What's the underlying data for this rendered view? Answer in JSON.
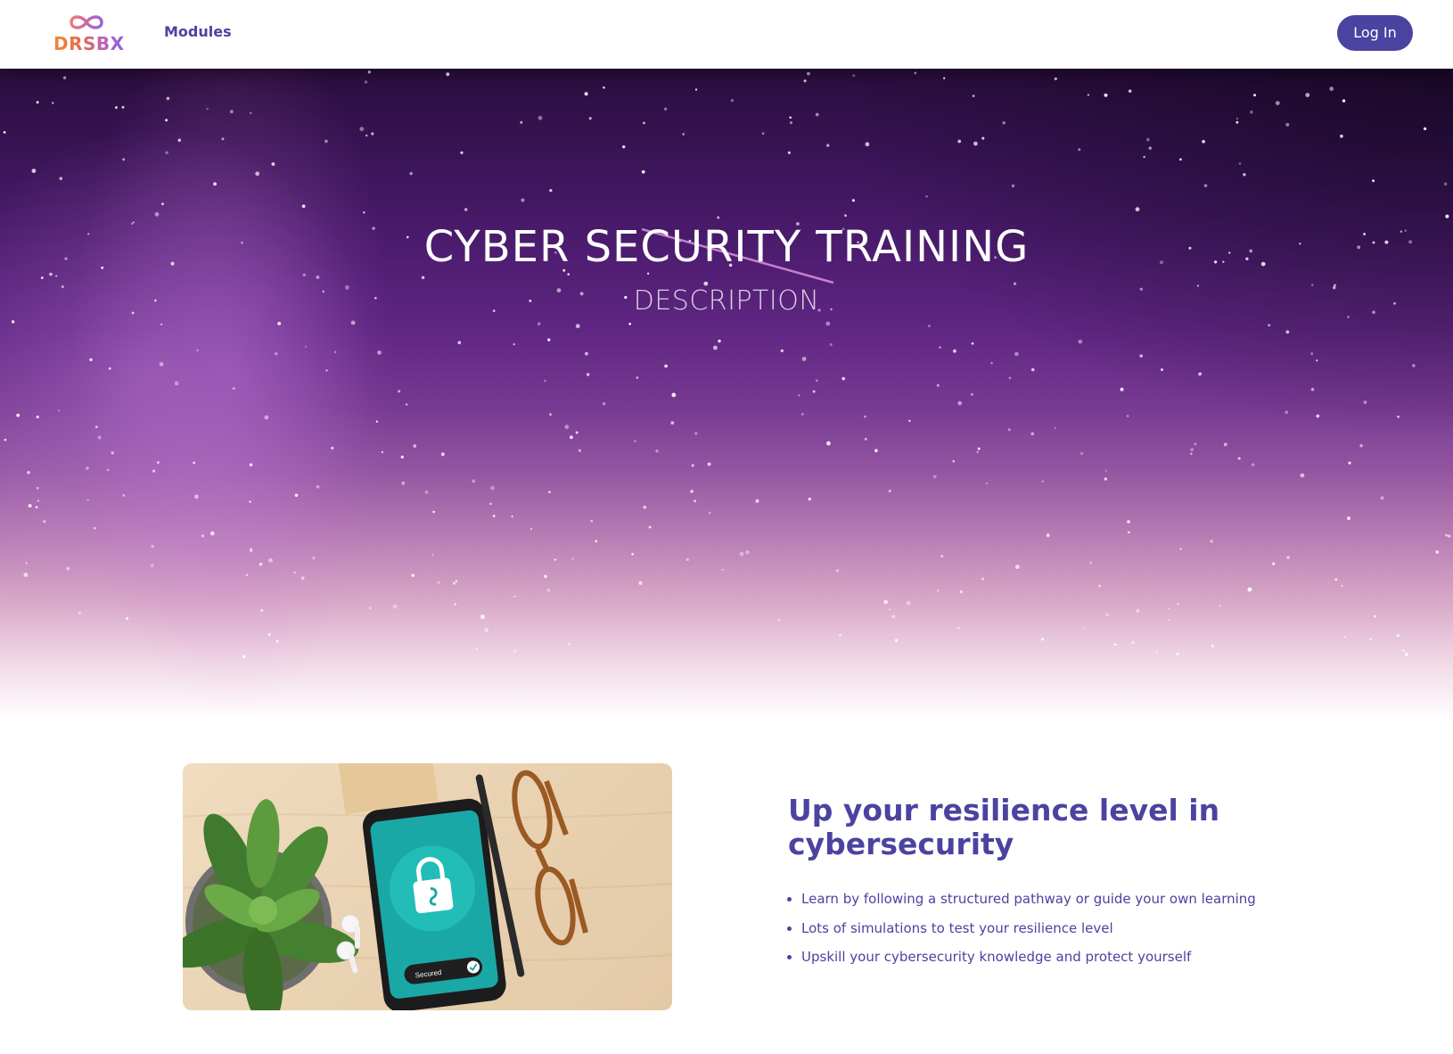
{
  "header": {
    "logo_text": "DRSBX",
    "nav_modules": "Modules",
    "login_label": "Log In"
  },
  "hero": {
    "title": "CYBER SECURITY TRAINING",
    "subtitle": "DESCRIPTION"
  },
  "feature": {
    "image_caption": "Secured",
    "heading": "Up your resilience level in cybersecurity",
    "bullets": [
      "Learn by following a structured pathway or guide your own learning",
      "Lots of simulations to test your resilience level",
      "Upskill your cybersecurity knowledge and protect yourself"
    ]
  },
  "colors": {
    "brand_purple": "#4b43a0",
    "logo_orange": "#f08a3a",
    "logo_violet": "#8b5fd6"
  }
}
